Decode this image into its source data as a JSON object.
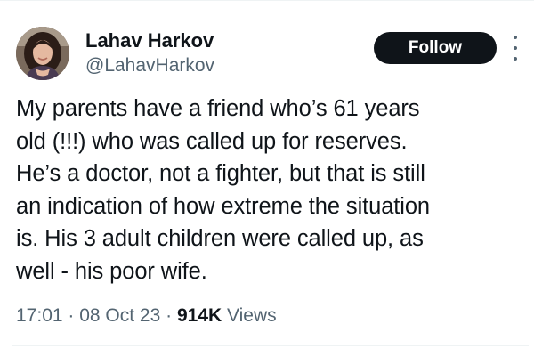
{
  "author": {
    "display_name": "Lahav Harkov",
    "handle": "@LahavHarkov",
    "avatar_icon": "profile-photo"
  },
  "actions": {
    "follow_label": "Follow",
    "more_icon": "more-options-icon"
  },
  "tweet": {
    "lines": [
      "My parents have a friend who’s 61 years",
      "old (!!!) who was called up for reserves.",
      "He’s a doctor, not a fighter, but that is still",
      "an indication of how extreme the situation",
      "is. His 3 adult children were called up, as",
      "well - his poor wife."
    ]
  },
  "meta": {
    "time": "17:01",
    "separator": " · ",
    "date": "08 Oct 23",
    "views_count": "914K",
    "views_label": " Views"
  },
  "colors": {
    "text": "#0f1419",
    "secondary": "#536471",
    "button_bg": "#0f1419",
    "button_text": "#ffffff"
  }
}
